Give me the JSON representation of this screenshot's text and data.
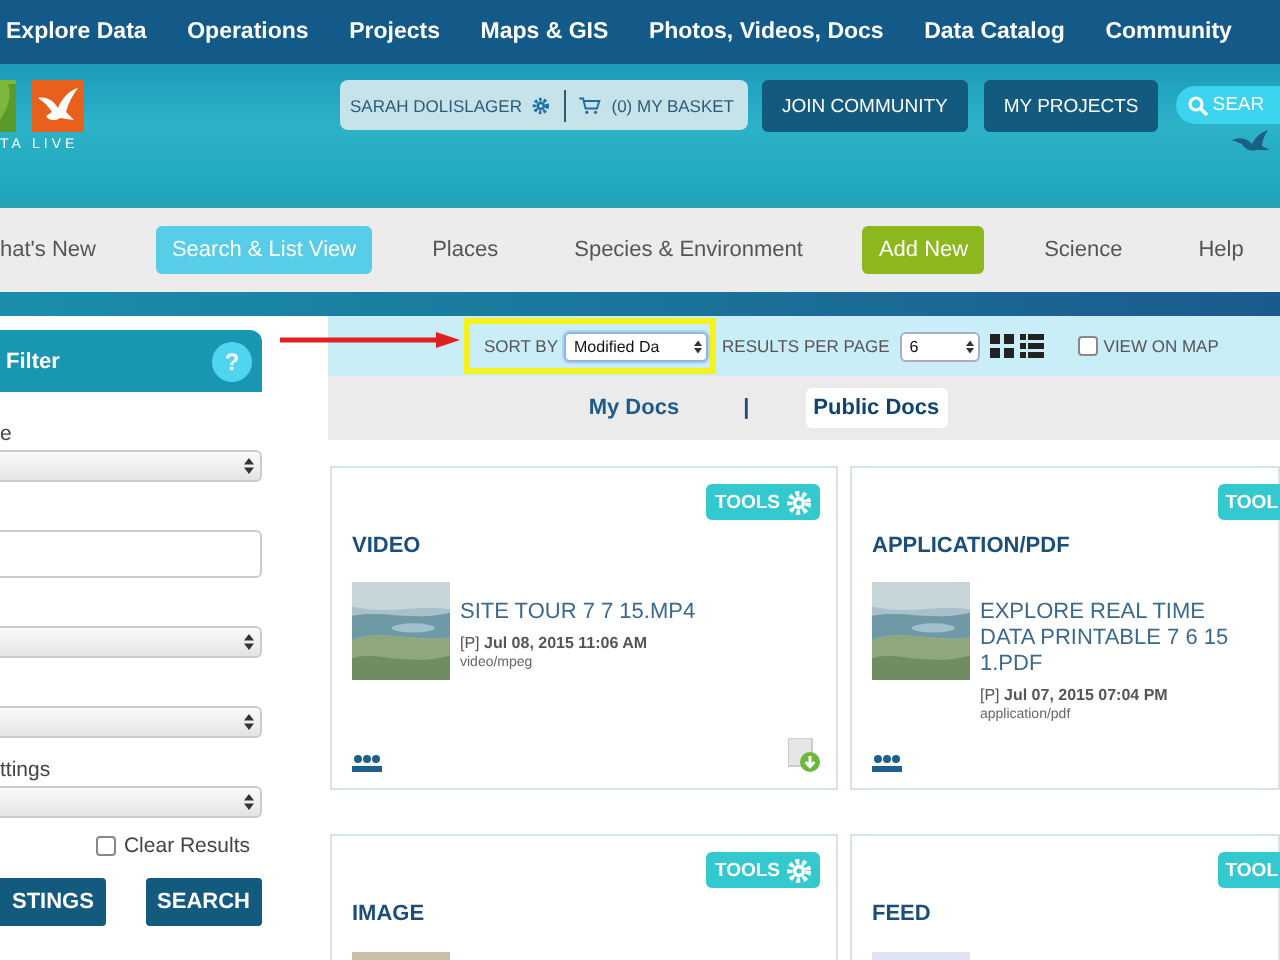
{
  "top_nav": [
    "Explore Data",
    "Operations",
    "Projects",
    "Maps & GIS",
    "Photos, Videos, Docs",
    "Data Catalog",
    "Community"
  ],
  "banner": {
    "logo_text": "TA LIVE",
    "user_name": "SARAH DOLISLAGER",
    "basket": "(0) MY BASKET",
    "buttons": [
      "JOIN COMMUNITY",
      "MY PROJECTS"
    ],
    "search_label": "SEAR"
  },
  "main_nav": [
    {
      "label": "hat's New",
      "kind": "plain",
      "selected": false
    },
    {
      "label": "Search & List View",
      "kind": "plain",
      "selected": true
    },
    {
      "label": "Places",
      "kind": "plain",
      "selected": false
    },
    {
      "label": "Species & Environment",
      "kind": "plain",
      "selected": false
    },
    {
      "label": "Add New",
      "kind": "action",
      "selected": false
    },
    {
      "label": "Science",
      "kind": "plain",
      "selected": false
    },
    {
      "label": "Help",
      "kind": "plain",
      "selected": false
    }
  ],
  "filter": {
    "title": "Filter",
    "help": "?",
    "fields": [
      {
        "kind": "select",
        "label": "e"
      },
      {
        "kind": "input"
      },
      {
        "kind": "select"
      },
      {
        "kind": "select"
      },
      {
        "kind": "select",
        "label": "ttings"
      }
    ],
    "clear_results": {
      "label": "Clear Results",
      "checked": false
    },
    "buttons": [
      "STINGS",
      "SEARCH"
    ]
  },
  "toolbar": {
    "sort_label": "SORT BY",
    "sort_value": "Modified Da",
    "results_label": "RESULTS PER PAGE",
    "results_value": "6",
    "view_on_map": {
      "label": "VIEW ON MAP",
      "checked": false
    }
  },
  "doc_tabs": [
    {
      "label": "My Docs",
      "selected": false
    },
    {
      "label": "Public Docs",
      "selected": true
    }
  ],
  "doc_tabs_separator": "|",
  "cards": [
    {
      "tools": "TOOLS",
      "gear": true,
      "type": "VIDEO",
      "title": "SITE TOUR 7 7 15.MP4",
      "flag": "[P]",
      "date": "Jul 08, 2015 11:06 AM",
      "mime": "video/mpeg",
      "download": true
    },
    {
      "tools": "TOOL",
      "gear": false,
      "type": "APPLICATION/PDF",
      "title": "EXPLORE REAL TIME DATA PRINTABLE 7 6 15 1.PDF",
      "flag": "[P]",
      "date": "Jul 07, 2015 07:04 PM",
      "mime": "application/pdf",
      "download": false
    },
    {
      "tools": "TOOLS",
      "gear": true,
      "type": "IMAGE"
    },
    {
      "tools": "TOOL",
      "gear": false,
      "type": "FEED"
    }
  ]
}
